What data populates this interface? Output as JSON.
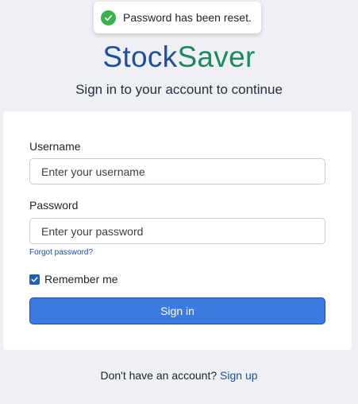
{
  "toast": {
    "message": "Password has been reset.",
    "icon": "check-circle-icon",
    "icon_color": "#37b24d"
  },
  "brand": {
    "part1": "Stock",
    "part2": "Saver",
    "part1_color": "#1f4e9a",
    "part2_color": "#1e8a5a"
  },
  "subtitle": "Sign in to your account to continue",
  "form": {
    "username_label": "Username",
    "username_placeholder": "Enter your username",
    "username_value": "",
    "password_label": "Password",
    "password_placeholder": "Enter your password",
    "password_value": "",
    "forgot_link": "Forgot password?",
    "remember_label": "Remember me",
    "remember_checked": true,
    "submit_label": "Sign in",
    "submit_color": "#3b7be0"
  },
  "footer": {
    "prompt": "Don't have an account?",
    "signup_link": "Sign up"
  }
}
